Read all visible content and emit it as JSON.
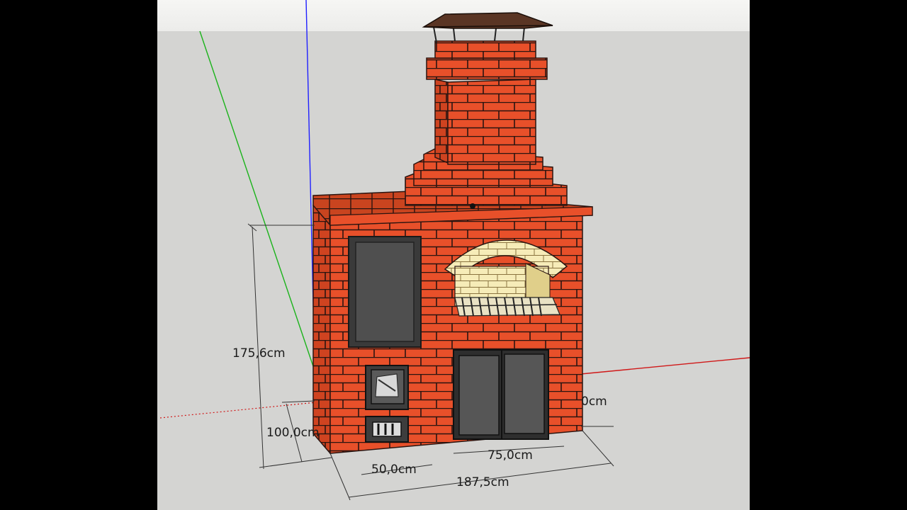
{
  "dimensions": {
    "total_height": "175,6cm",
    "base_height": "100,0cm",
    "firebox_width": "50,0cm",
    "doors_width": "75,0cm",
    "total_width": "187,5cm",
    "side_depth": "0cm"
  },
  "colors": {
    "viewport_bg": "#d4d4d2",
    "sky": "#f2f2f0",
    "brick": "#e8502a",
    "brick_dark": "#b8381a",
    "mortar": "#2a1410",
    "arch_brick": "#f5e7a8",
    "panel_dark": "#4b4b4b",
    "axis_green": "#1ab31a",
    "axis_blue": "#2020ff",
    "axis_red": "#d01818",
    "roof": "#5a3524"
  }
}
